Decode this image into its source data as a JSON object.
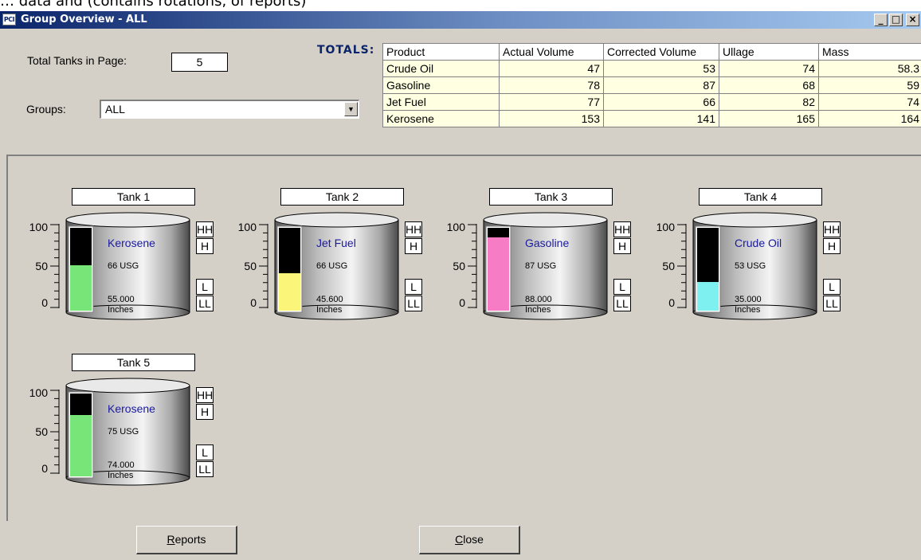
{
  "header_fragment": "… data and (contains rotations, of reports)",
  "window": {
    "app_icon_text": "PCI",
    "title": "Group Overview - ALL",
    "minimize_glyph": "_",
    "maximize_glyph": "□",
    "close_glyph": "×"
  },
  "filters": {
    "total_tanks_label": "Total Tanks in Page:",
    "total_tanks_value": "5",
    "groups_label": "Groups:",
    "groups_value": "ALL",
    "dropdown_glyph": "▼"
  },
  "totals": {
    "label": "TOTALS:",
    "columns": [
      "Product",
      "Actual Volume",
      "Corrected Volume",
      "Ullage",
      "Mass"
    ],
    "rows": [
      [
        "Crude Oil",
        "47",
        "53",
        "74",
        "58.3"
      ],
      [
        "Gasoline",
        "78",
        "87",
        "68",
        "59"
      ],
      [
        "Jet Fuel",
        "77",
        "66",
        "82",
        "74"
      ],
      [
        "Kerosene",
        "153",
        "141",
        "165",
        "164"
      ]
    ]
  },
  "scale": {
    "top": "100",
    "mid": "50",
    "bottom": "0"
  },
  "alarms": {
    "hh": "HH",
    "h": "H",
    "l": "L",
    "ll": "LL"
  },
  "tanks": [
    {
      "name": "Tank 1",
      "product": "Kerosene",
      "volume": "66 USG",
      "level": "55.000",
      "unit": "Inches",
      "fill_fraction": 0.55,
      "fill_color": "#77e577"
    },
    {
      "name": "Tank 2",
      "product": "Jet Fuel",
      "volume": "66 USG",
      "level": "45.600",
      "unit": "Inches",
      "fill_fraction": 0.456,
      "fill_color": "#fbf57a"
    },
    {
      "name": "Tank 3",
      "product": "Gasoline",
      "volume": "87 USG",
      "level": "88.000",
      "unit": "Inches",
      "fill_fraction": 0.88,
      "fill_color": "#f77cc6"
    },
    {
      "name": "Tank 4",
      "product": "Crude Oil",
      "volume": "53 USG",
      "level": "35.000",
      "unit": "Inches",
      "fill_fraction": 0.35,
      "fill_color": "#7ff0f0"
    },
    {
      "name": "Tank 5",
      "product": "Kerosene",
      "volume": "75 USG",
      "level": "74.000",
      "unit": "Inches",
      "fill_fraction": 0.74,
      "fill_color": "#77e577"
    }
  ],
  "buttons": {
    "reports_first": "R",
    "reports_rest": "eports",
    "close_first": "C",
    "close_rest": "lose"
  },
  "colors": {
    "window_bg": "#d4d0c8",
    "title_blue": "#0a246a",
    "grid_row_bg": "#ffffe1",
    "empty_column": "#000000"
  }
}
